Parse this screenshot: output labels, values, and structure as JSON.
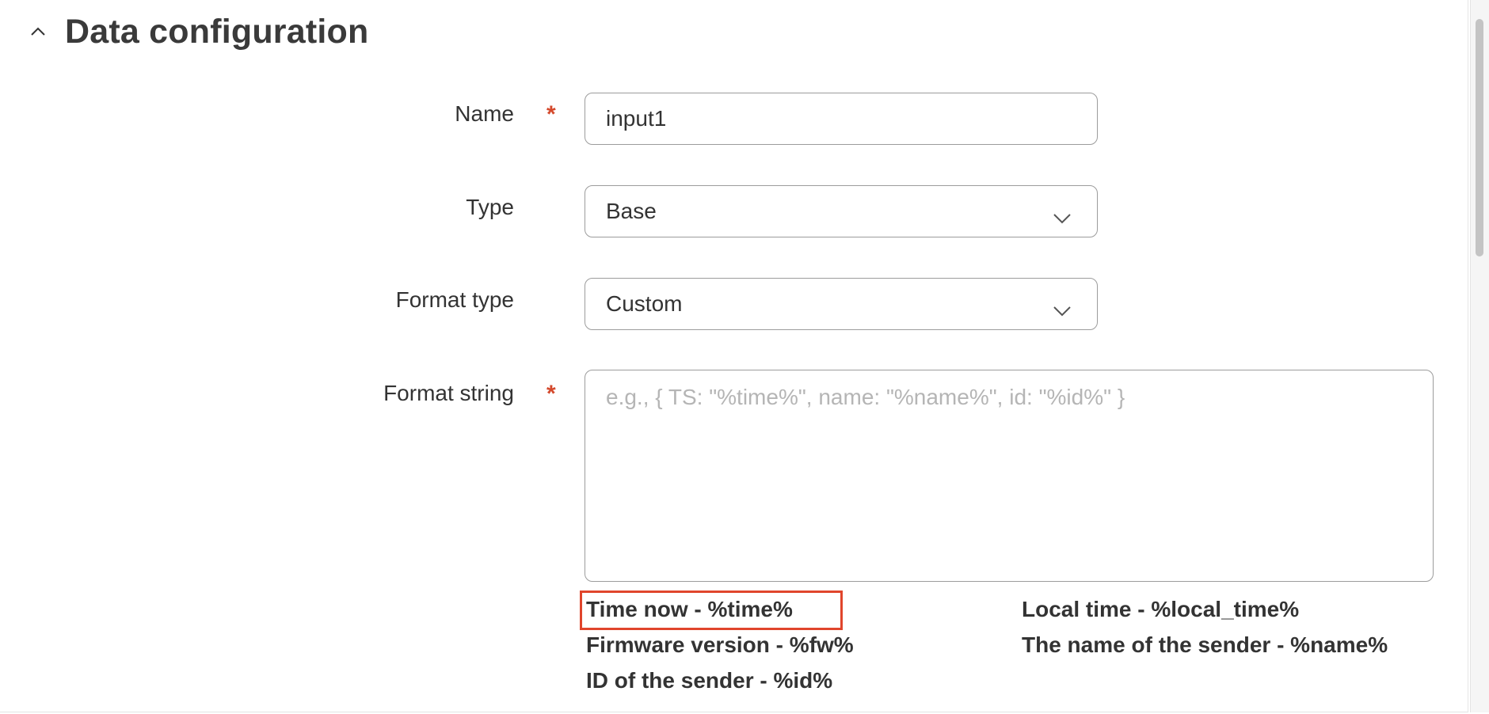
{
  "section": {
    "title": "Data configuration",
    "toggle_icon": "chevron-up-icon"
  },
  "form": {
    "name": {
      "label": "Name",
      "required_mark": "*",
      "value": "input1"
    },
    "type": {
      "label": "Type",
      "value": "Base",
      "icon": "chevron-down-icon"
    },
    "format_type": {
      "label": "Format type",
      "value": "Custom",
      "icon": "chevron-down-icon"
    },
    "format_string": {
      "label": "Format string",
      "required_mark": "*",
      "value": "",
      "placeholder": "e.g., { TS: \"%time%\", name: \"%name%\", id: \"%id%\" }"
    }
  },
  "hints": {
    "time_now": "Time now - %time%",
    "local_time": "Local time - %local_time%",
    "firmware_version": "Firmware version - %fw%",
    "sender_name": "The name of the sender - %name%",
    "sender_id": "ID of the sender - %id%"
  },
  "colors": {
    "required": "#d4492c",
    "highlight": "#e0452c",
    "border": "#9c9c9c",
    "placeholder": "#b5b5b5"
  }
}
